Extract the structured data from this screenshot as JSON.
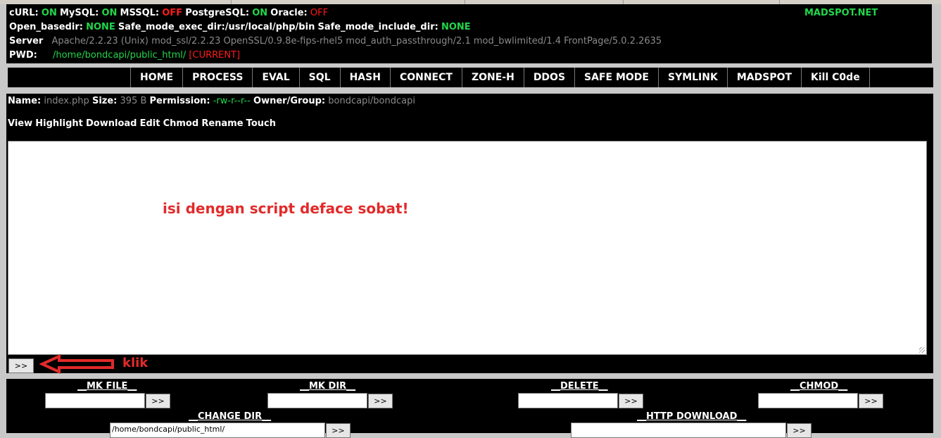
{
  "header": {
    "status": [
      {
        "label": "cURL:",
        "value": "ON"
      },
      {
        "label": "MySQL:",
        "value": "ON"
      },
      {
        "label": "MSSQL:",
        "value": "OFF"
      },
      {
        "label": "PostgreSQL:",
        "value": "ON"
      },
      {
        "label": "Oracle:",
        "value": "OFF"
      }
    ],
    "brand": "MADSPOT.NET",
    "open_basedir_label": "Open_basedir:",
    "open_basedir_value": "NONE",
    "safe_exec_label": "Safe_mode_exec_dir:/usr/local/php/bin",
    "safe_include_label": "Safe_mode_include_dir:",
    "safe_include_value": "NONE",
    "server_label": "Server",
    "server_value": "Apache/2.2.23 (Unix) mod_ssl/2.2.23 OpenSSL/0.9.8e-fips-rhel5 mod_auth_passthrough/2.1 mod_bwlimited/1.4 FrontPage/5.0.2.2635",
    "pwd_label": "PWD:",
    "pwd_value": "/home/bondcapi/public_html/",
    "pwd_current": "[CURRENT]"
  },
  "nav": [
    "HOME",
    "PROCESS",
    "EVAL",
    "SQL",
    "HASH",
    "CONNECT",
    "ZONE-H",
    "DDOS",
    "SAFE MODE",
    "SYMLINK",
    "MADSPOT",
    "Kill C0de"
  ],
  "file": {
    "name_label": "Name:",
    "name_value": "index.php",
    "size_label": "Size:",
    "size_value": "395 B",
    "perm_label": "Permission:",
    "perm_value": "-rw-r--r--",
    "owner_label": "Owner/Group:",
    "owner_value": "bondcapi/bondcapi",
    "actions": [
      "View",
      "Highlight",
      "Download",
      "Edit",
      "Chmod",
      "Rename",
      "Touch"
    ]
  },
  "editor": {
    "content": "isi dengan script deface sobat!",
    "submit_label": ">>"
  },
  "annotation": {
    "text": "klik"
  },
  "tools": {
    "mkfile": "__MK FILE__",
    "mkdir": "__MK DIR__",
    "delete": "__DELETE__",
    "chmod": "__CHMOD__",
    "changedir": "__CHANGE DIR__",
    "httpdownload": "__HTTP DOWNLOAD__",
    "changedir_value": "/home/bondcapi/public_html/",
    "go_label": ">>"
  },
  "colors": {
    "on": "#21d64a",
    "off": "#ff1a1a",
    "annotation": "#e22a2a"
  }
}
